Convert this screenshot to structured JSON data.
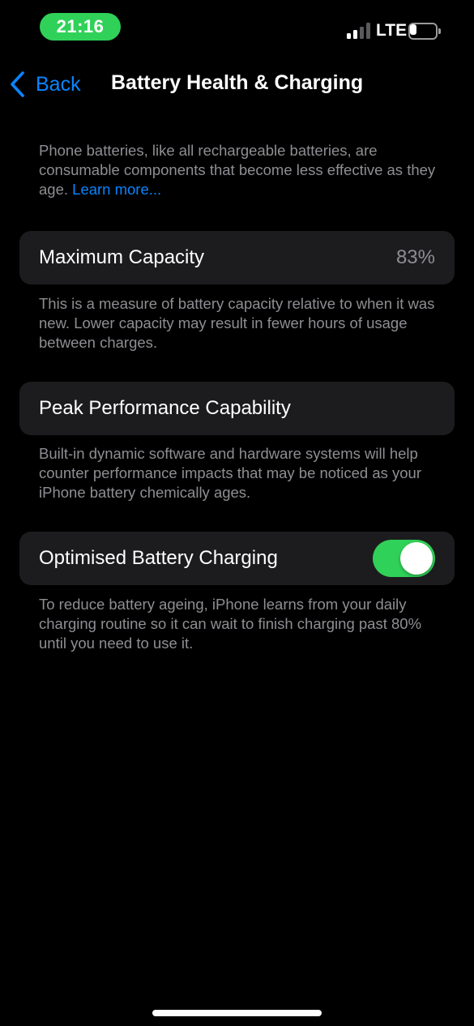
{
  "status_bar": {
    "time": "21:16",
    "network": "LTE",
    "battery_level": 0.3,
    "time_pill_color": "#30d158"
  },
  "nav": {
    "back_label": "Back",
    "back_icon": "chevron-left-icon",
    "title": "Battery Health & Charging",
    "accent_color": "#0a84ff"
  },
  "intro": {
    "text": "Phone batteries, like all rechargeable batteries, are consumable components that become less effective as they age. ",
    "link": "Learn more..."
  },
  "maximum_capacity": {
    "label": "Maximum Capacity",
    "value": "83%",
    "footnote": "This is a measure of battery capacity relative to when it was new. Lower capacity may result in fewer hours of usage between charges."
  },
  "peak_performance": {
    "label": "Peak Performance Capability",
    "footnote": "Built-in dynamic software and hardware systems will help counter performance impacts that may be noticed as your iPhone battery chemically ages."
  },
  "optimised_charging": {
    "label": "Optimised Battery Charging",
    "enabled": true,
    "toggle_color": "#30d158",
    "footnote": "To reduce battery ageing, iPhone learns from your daily charging routine so it can wait to finish charging past 80% until you need to use it."
  }
}
